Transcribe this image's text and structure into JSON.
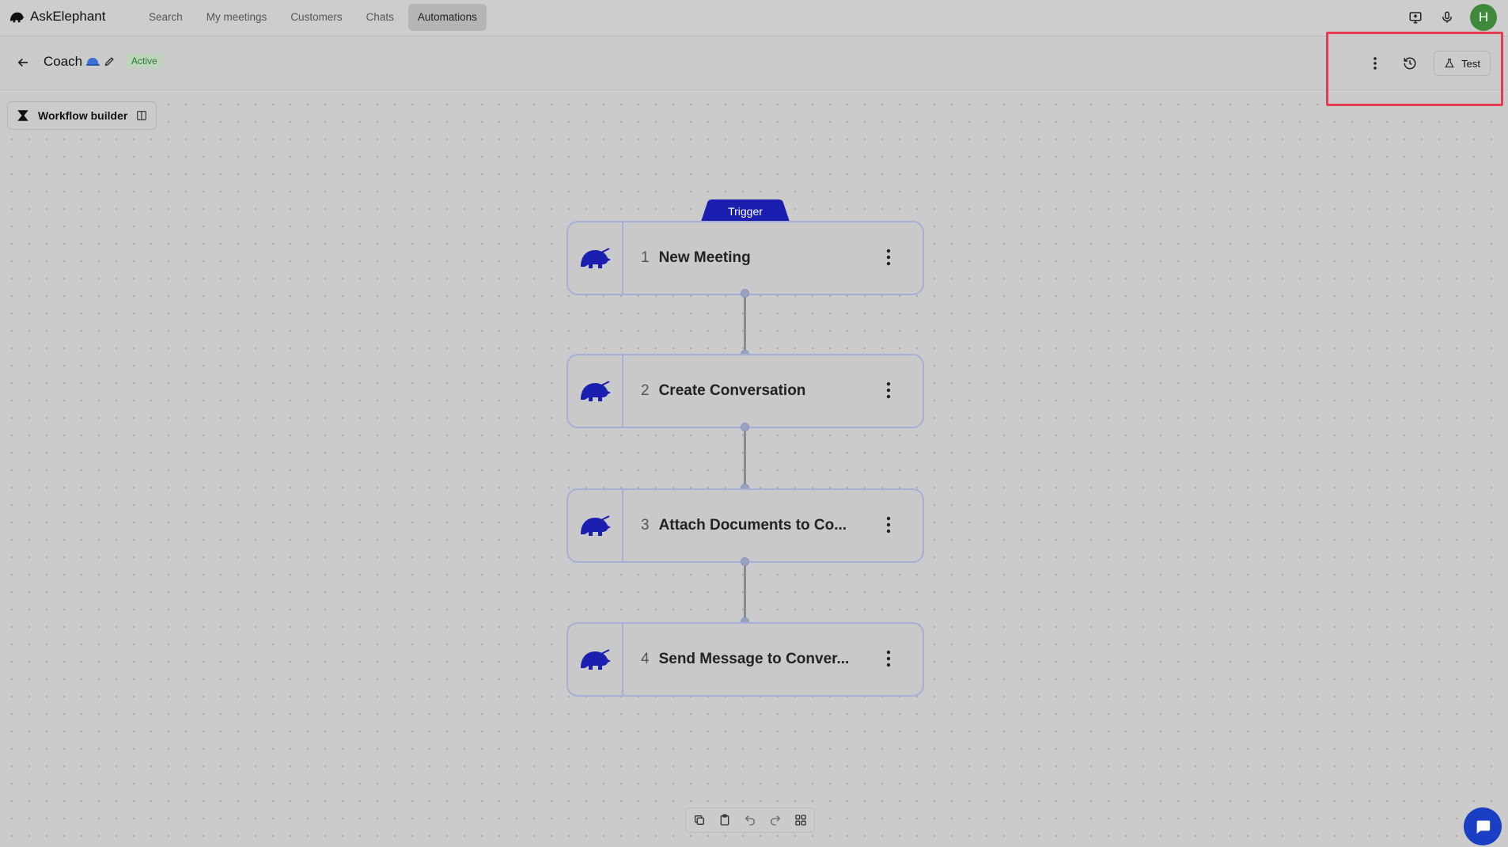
{
  "app": {
    "brand": "AskElephant"
  },
  "nav": {
    "items": [
      {
        "label": "Search"
      },
      {
        "label": "My meetings"
      },
      {
        "label": "Customers"
      },
      {
        "label": "Chats"
      },
      {
        "label": "Automations",
        "active": true
      }
    ]
  },
  "user": {
    "initial": "H",
    "avatar_color": "#3f8a3a"
  },
  "workflow": {
    "title": "Coach",
    "status": "Active",
    "test_label": "Test",
    "builder_label": "Workflow builder",
    "trigger_label": "Trigger",
    "steps": [
      {
        "num": "1",
        "label": "New Meeting"
      },
      {
        "num": "2",
        "label": "Create Conversation"
      },
      {
        "num": "3",
        "label": "Attach Documents to Co..."
      },
      {
        "num": "4",
        "label": "Send Message to Conver..."
      }
    ]
  },
  "colors": {
    "brand_blue": "#1a1fb0",
    "highlight_red": "#e53a52",
    "status_green": "#2a7a2a"
  }
}
